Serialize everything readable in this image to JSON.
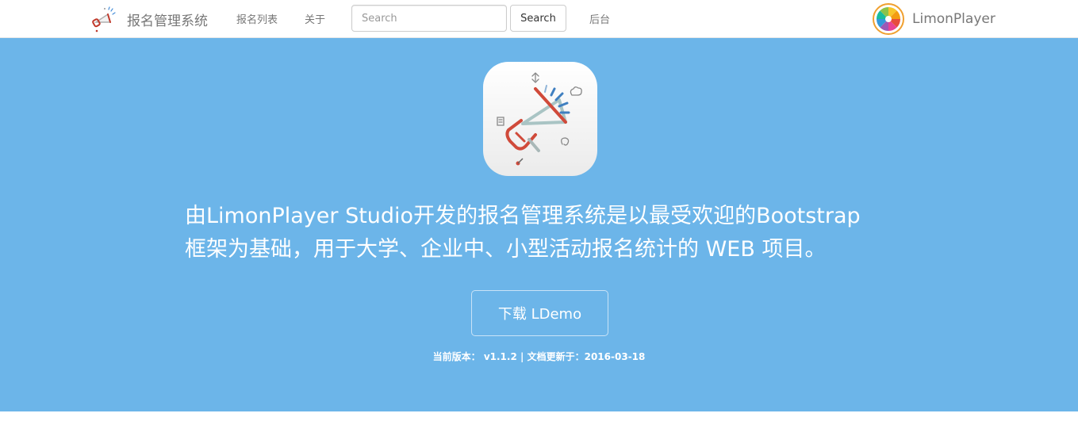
{
  "navbar": {
    "brand_title": "报名管理系统",
    "links": {
      "list": "报名列表",
      "about": "关于",
      "admin": "后台"
    },
    "search": {
      "placeholder": "Search",
      "value": "",
      "button_label": "Search"
    },
    "user": {
      "name": "LimonPlayer"
    }
  },
  "hero": {
    "background_color": "#6cb5e9",
    "icon": "megaphone-icon",
    "description_line_1": "由LimonPlayer Studio开发的报名管理系统是以最受欢迎的Bootstrap",
    "description_line_2": "框架为基础，用于大学、企业中、小型活动报名统计的 WEB 项目。",
    "download_button_label": "下载 LDemo",
    "version": {
      "label": "当前版本：",
      "value": "v1.1.2",
      "separator": "|",
      "updated_label": "文档更新于：",
      "updated_date": "2016-03-18"
    }
  }
}
